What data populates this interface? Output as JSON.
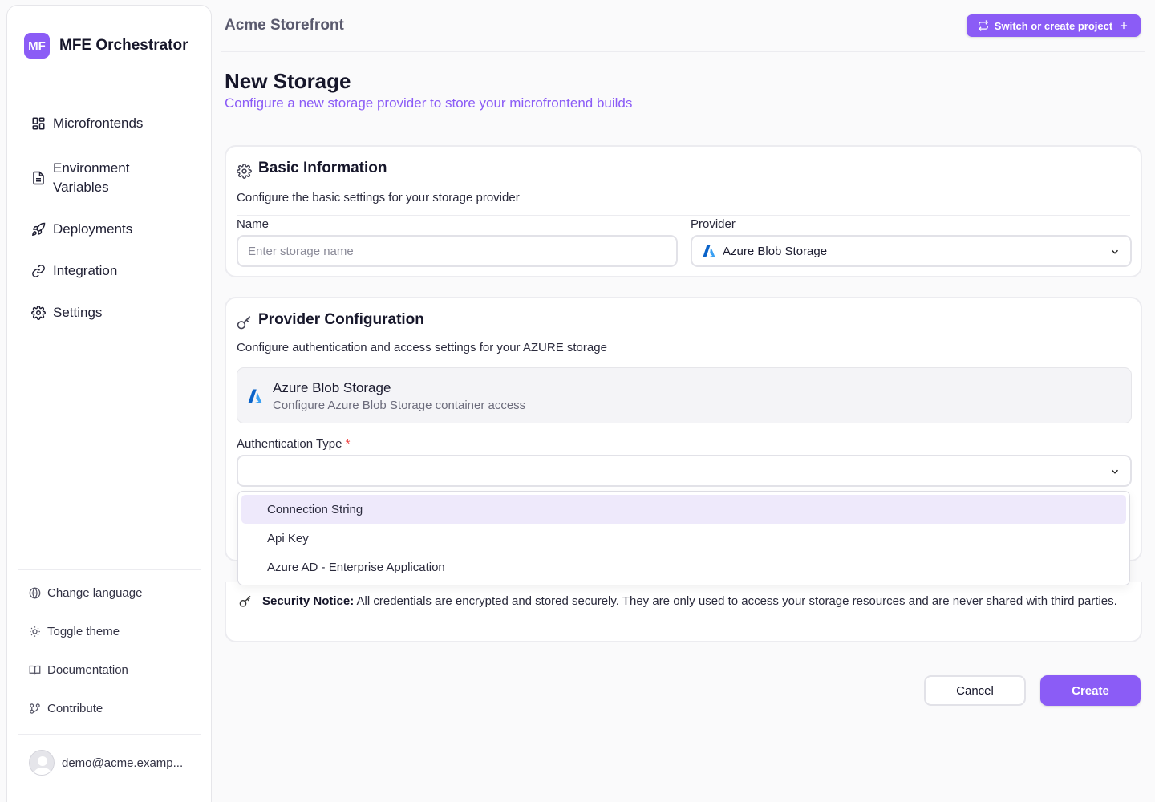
{
  "brand": {
    "logo_text": "MF",
    "name": "MFE Orchestrator"
  },
  "nav": {
    "items": [
      {
        "label": "Microfrontends",
        "icon": "grid-icon"
      },
      {
        "label": "Environment Variables",
        "icon": "file-text-icon"
      },
      {
        "label": "Deployments",
        "icon": "rocket-icon"
      },
      {
        "label": "Integration",
        "icon": "link-icon"
      },
      {
        "label": "Settings",
        "icon": "gear-icon"
      }
    ]
  },
  "sidebar_footer": {
    "change_language": "Change language",
    "toggle_theme": "Toggle theme",
    "documentation": "Documentation",
    "contribute": "Contribute",
    "user_email": "demo@acme.examp..."
  },
  "topbar": {
    "project": "Acme Storefront",
    "switch_label": "Switch or create project"
  },
  "page": {
    "title": "New Storage",
    "subtitle": "Configure a new storage provider to store your microfrontend builds"
  },
  "basic": {
    "title": "Basic Information",
    "description": "Configure the basic settings for your storage provider",
    "name_label": "Name",
    "name_placeholder": "Enter storage name",
    "name_value": "",
    "provider_label": "Provider",
    "provider_value": "Azure Blob Storage"
  },
  "provider_config": {
    "title": "Provider Configuration",
    "description": "Configure authentication and access settings for your AZURE storage",
    "box_title": "Azure Blob Storage",
    "box_desc": "Configure Azure Blob Storage container access",
    "auth_label": "Authentication Type",
    "auth_required_mark": "*",
    "auth_value": "",
    "options": [
      "Connection String",
      "Api Key",
      "Azure AD - Enterprise Application"
    ],
    "highlighted_option": "Connection String"
  },
  "notice": {
    "bold": "Security Notice:",
    "text": " All credentials are encrypted and stored securely. They are only used to access your storage resources and are never shared with third parties."
  },
  "actions": {
    "cancel": "Cancel",
    "create": "Create"
  },
  "colors": {
    "accent": "#8b5cf6",
    "highlight": "#eee9fb",
    "required": "#ef4444",
    "azure_blue": "#0078d4"
  }
}
